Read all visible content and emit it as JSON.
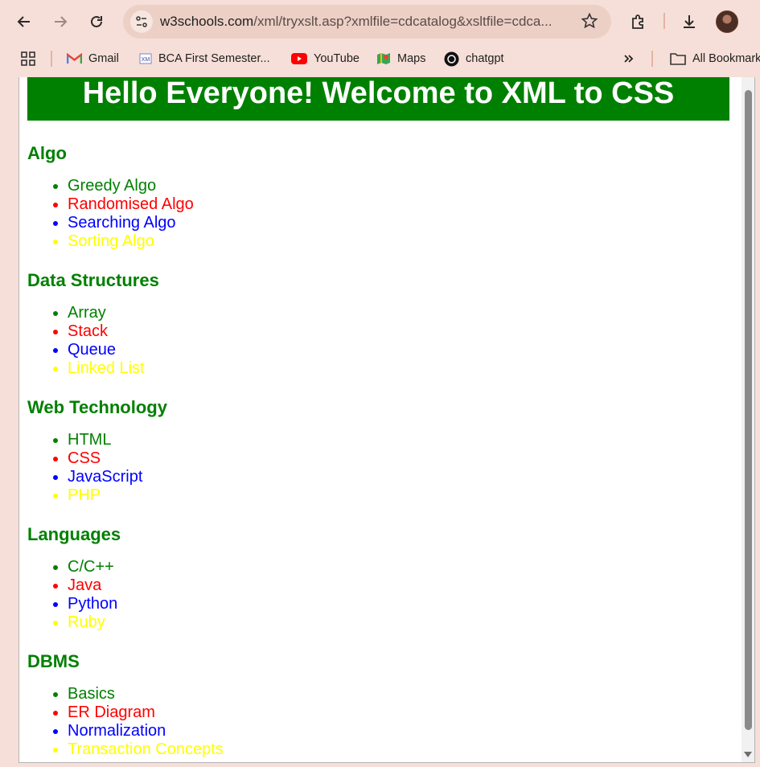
{
  "browser": {
    "url_host": "w3schools.com",
    "url_path": "/xml/tryxslt.asp?xmlfile=cdcatalog&xsltfile=cdca..."
  },
  "bookmarks": [
    {
      "label": "Gmail",
      "icon": "gmail-icon"
    },
    {
      "label": "BCA First Semester...",
      "icon": "bca-icon"
    },
    {
      "label": "YouTube",
      "icon": "youtube-icon"
    },
    {
      "label": "Maps",
      "icon": "maps-icon"
    },
    {
      "label": "chatgpt",
      "icon": "chatgpt-icon"
    },
    {
      "label": "All Bookmarks",
      "icon": "folder-icon"
    }
  ],
  "page": {
    "heading": "Hello Everyone! Welcome to XML to CSS",
    "sections": [
      {
        "title": "Algo",
        "items": [
          "Greedy Algo",
          "Randomised Algo",
          "Searching Algo",
          "Sorting Algo"
        ]
      },
      {
        "title": "Data Structures",
        "items": [
          "Array",
          "Stack",
          "Queue",
          "Linked List"
        ]
      },
      {
        "title": "Web Technology",
        "items": [
          "HTML",
          "CSS",
          "JavaScript",
          "PHP"
        ]
      },
      {
        "title": "Languages",
        "items": [
          "C/C++",
          "Java",
          "Python",
          "Ruby"
        ]
      },
      {
        "title": "DBMS",
        "items": [
          "Basics",
          "ER Diagram",
          "Normalization",
          "Transaction Concepts"
        ]
      }
    ]
  },
  "colors": {
    "heading_bg": "#008000",
    "item_colors": [
      "#008000",
      "#ff0000",
      "#0000ff",
      "#ffff00"
    ],
    "browser_chrome": "#f6dfd8"
  }
}
